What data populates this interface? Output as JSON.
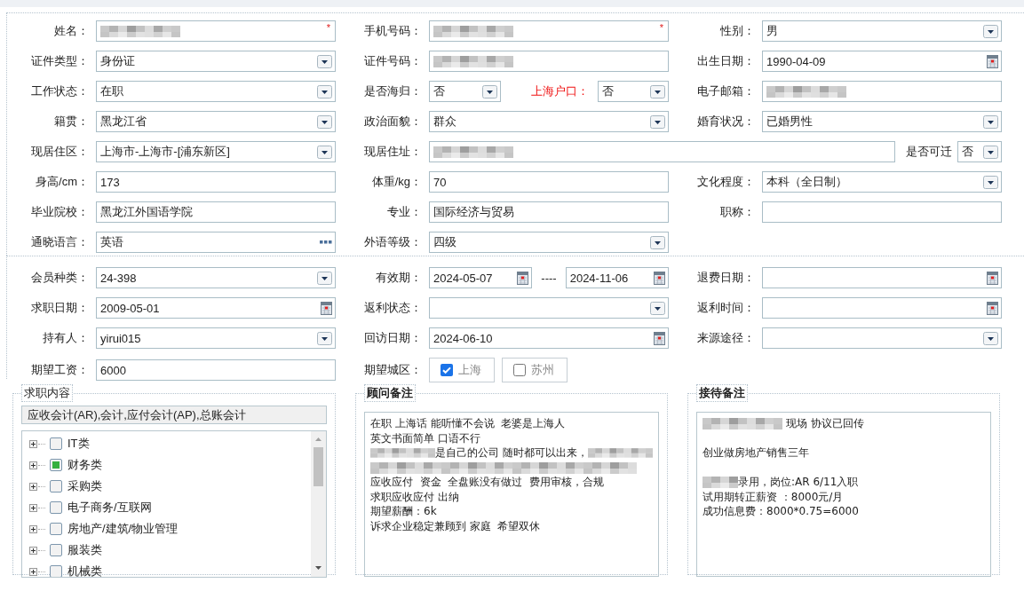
{
  "personal": {
    "rows": [
      [
        {
          "label": "姓名：",
          "kind": "text",
          "redacted": true,
          "marker": "*"
        },
        {
          "label": "手机号码：",
          "kind": "text",
          "redacted": true,
          "marker": "*"
        },
        {
          "label": "性别：",
          "kind": "select",
          "value": "男"
        }
      ],
      [
        {
          "label": "证件类型：",
          "kind": "select",
          "value": "身份证"
        },
        {
          "label": "证件号码：",
          "kind": "text",
          "redacted": true
        },
        {
          "label": "出生日期：",
          "kind": "date",
          "value": "1990-04-09"
        }
      ],
      [
        {
          "label": "工作状态：",
          "kind": "select",
          "value": "在职"
        },
        {
          "label": "是否海归：",
          "kind": "select",
          "value": "否",
          "extra": {
            "label": "上海户口：",
            "emphasis": true,
            "kind": "select",
            "value": "否"
          }
        },
        {
          "label": "电子邮箱：",
          "kind": "text",
          "redacted": true
        }
      ],
      [
        {
          "label": "籍贯：",
          "kind": "select",
          "value": "黑龙江省"
        },
        {
          "label": "政治面貌：",
          "kind": "select",
          "value": "群众"
        },
        {
          "label": "婚育状况：",
          "kind": "select",
          "value": "已婚男性"
        }
      ],
      [
        {
          "label": "现居住区：",
          "kind": "select",
          "value": "上海市-上海市-[浦东新区]"
        },
        {
          "label": "现居住址：",
          "kind": "text",
          "redacted": true,
          "extra": {
            "label": "是否可迁",
            "kind": "select",
            "value": "否"
          }
        }
      ],
      [
        {
          "label": "身高/cm：",
          "kind": "text",
          "value": "173"
        },
        {
          "label": "体重/kg：",
          "kind": "text",
          "value": "70"
        },
        {
          "label": "文化程度：",
          "kind": "select",
          "value": "本科（全日制）"
        }
      ],
      [
        {
          "label": "毕业院校：",
          "kind": "text",
          "value": "黑龙江外国语学院"
        },
        {
          "label": "专业：",
          "kind": "text",
          "value": "国际经济与贸易"
        },
        {
          "label": "职称：",
          "kind": "text"
        }
      ],
      [
        {
          "label": "通晓语言：",
          "kind": "lookup",
          "value": "英语"
        },
        {
          "label": "外语等级：",
          "kind": "select",
          "value": "四级"
        }
      ]
    ]
  },
  "membership": {
    "rows": [
      [
        {
          "label": "会员种类：",
          "kind": "select",
          "value": "24-398"
        },
        {
          "label": "有效期：",
          "kind": "date",
          "value": "2024-05-07",
          "extra": {
            "label": "----",
            "kind": "date",
            "value": "2024-11-06"
          }
        },
        {
          "label": "退费日期：",
          "kind": "date"
        }
      ],
      [
        {
          "label": "求职日期：",
          "kind": "date",
          "value": "2009-05-01"
        },
        {
          "label": "返利状态：",
          "kind": "select"
        },
        {
          "label": "返利时间：",
          "kind": "date"
        }
      ],
      [
        {
          "label": "持有人：",
          "kind": "select",
          "value": "yirui015"
        },
        {
          "label": "回访日期：",
          "kind": "date",
          "value": "2024-06-10"
        },
        {
          "label": "来源途径：",
          "kind": "select"
        }
      ],
      [
        {
          "label": "期望工资：",
          "kind": "text",
          "value": "6000"
        },
        {
          "label": "期望城区：",
          "kind": "checkboxes",
          "options": [
            {
              "label": "上海",
              "checked": true
            },
            {
              "label": "苏州",
              "checked": false
            }
          ]
        }
      ]
    ]
  },
  "panels": [
    {
      "kind": "tree",
      "legend": "求职内容",
      "summary": "应收会计(AR),会计,应付会计(AP),总账会计",
      "items": [
        {
          "label": "IT类",
          "partial": false,
          "expanded": false
        },
        {
          "label": "财务类",
          "partial": true,
          "expanded": false
        },
        {
          "label": "采购类",
          "partial": false,
          "expanded": false
        },
        {
          "label": "电子商务/互联网",
          "partial": false,
          "expanded": false
        },
        {
          "label": "房地产/建筑/物业管理",
          "partial": false,
          "expanded": false
        },
        {
          "label": "服装类",
          "partial": false,
          "expanded": false
        },
        {
          "label": "机械类",
          "partial": false,
          "expanded": false
        }
      ]
    },
    {
      "kind": "notes",
      "legend": "顾问备注",
      "paragraphs": [
        [
          [
            {
              "text": "在职 上海话 能听懂不会说  老婆是上海人"
            }
          ],
          [
            {
              "text": "英文书面简单 口语不行"
            }
          ],
          [
            {
              "kind": "redacted"
            },
            {
              "text": "是自己的公司 随时都可以出来，"
            },
            {
              "kind": "redacted"
            }
          ],
          [
            {
              "kind": "redacted-long"
            }
          ],
          [
            {
              "text": "应收应付  资金  全盘账没有做过  费用审核，合规"
            }
          ],
          [
            {
              "text": "求职应收应付 出纳"
            }
          ],
          [
            {
              "text": "期望薪酬：6k"
            }
          ],
          [
            {
              "text": "诉求企业稳定兼顾到 家庭  希望双休"
            }
          ]
        ]
      ]
    },
    {
      "kind": "notes",
      "legend": "接待备注",
      "paragraphs": [
        [
          [
            {
              "kind": "redacted"
            },
            {
              "text": " 现场 协议已回传"
            }
          ]
        ],
        [
          [
            {
              "text": "创业做房地产销售三年"
            }
          ]
        ],
        [
          [
            {
              "kind": "redacted-short"
            },
            {
              "text": "录用，岗位:AR 6/11入职"
            }
          ],
          [
            {
              "text": "试用期转正薪资 ：8000元/月"
            }
          ],
          [
            {
              "text": "成功信息费：8000*0.75=6000"
            }
          ]
        ]
      ]
    }
  ]
}
